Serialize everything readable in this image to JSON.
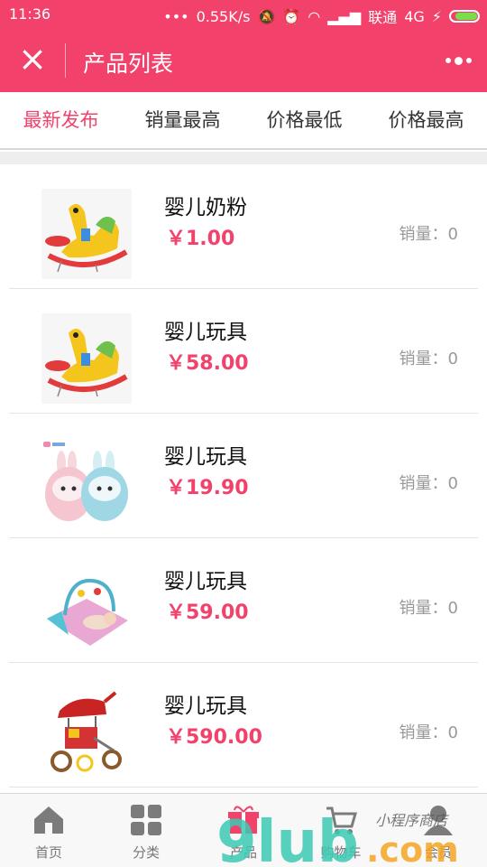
{
  "status_bar": {
    "time": "11:36",
    "speed": "0.55K/s",
    "carrier": "联通",
    "network": "4G"
  },
  "nav": {
    "title": "产品列表"
  },
  "tabs": [
    "最新发布",
    "销量最高",
    "价格最低",
    "价格最高"
  ],
  "products": [
    {
      "name": "婴儿奶粉",
      "price": "￥1.00",
      "sales": "销量：0",
      "image": "rocking-horse"
    },
    {
      "name": "婴儿玩具",
      "price": "￥58.00",
      "sales": "销量：0",
      "image": "rocking-horse"
    },
    {
      "name": "婴儿玩具",
      "price": "￥19.90",
      "sales": "销量：0",
      "image": "rabbit-tumblers"
    },
    {
      "name": "婴儿玩具",
      "price": "￥59.00",
      "sales": "销量：0",
      "image": "baby-play-mat"
    },
    {
      "name": "婴儿玩具",
      "price": "￥590.00",
      "sales": "销量：0",
      "image": "kids-tricycle"
    }
  ],
  "tabbar": [
    {
      "label": "首页",
      "icon": "home-icon"
    },
    {
      "label": "分类",
      "icon": "grid-icon"
    },
    {
      "label": "产品",
      "icon": "gift-icon"
    },
    {
      "label": "购物车",
      "icon": "cart-icon"
    },
    {
      "label": "会员",
      "icon": "user-icon"
    }
  ],
  "watermark": {
    "text1": "9lub",
    "text2": ".com",
    "text3": "小程序商店"
  },
  "colors": {
    "accent": "#f2416b"
  }
}
